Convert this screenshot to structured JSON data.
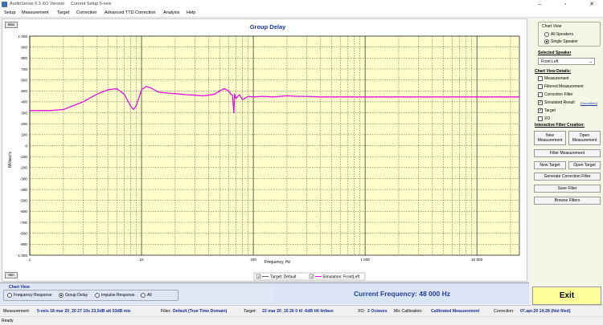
{
  "window": {
    "app_title": "AudioSense 6.3 XO Version",
    "caption": "Current Setup 5-veis",
    "minimize": "–",
    "maximize": "▫",
    "close": "✕"
  },
  "menu": [
    "Setup",
    "Measurement",
    "Target",
    "Correction",
    "Advanced TTD Correction",
    "Analysis",
    "Help"
  ],
  "chart": {
    "max_button": "Max",
    "min_button": "Min"
  },
  "chart_data": {
    "type": "line",
    "title": "Group Delay",
    "xlabel": "Frequency, Hz",
    "ylabel": "Millisec's",
    "x_scale": "log",
    "xlim": [
      1,
      24000
    ],
    "ylim": [
      -1000,
      1000
    ],
    "x_ticks": [
      1,
      10,
      100,
      1000,
      10000
    ],
    "x_tick_labels": [
      "1",
      "10",
      "100",
      "1 000",
      "10 000"
    ],
    "y_ticks": [
      1000,
      900,
      800,
      700,
      600,
      500,
      400,
      300,
      200,
      100,
      0,
      -100,
      -200,
      -300,
      -400,
      -500,
      -600,
      -700,
      -800,
      -900,
      -1000
    ],
    "y_tick_labels": [
      "1 000",
      "900",
      "800",
      "700",
      "600",
      "500",
      "400",
      "300",
      "200",
      "100",
      "0",
      "-100",
      "-200",
      "-300",
      "-400",
      "-500",
      "-600",
      "-700",
      "-800",
      "-900",
      "-1 000"
    ],
    "grid": true,
    "background": "#ffffcc",
    "series": [
      {
        "name": "Simulation: FrontLeft",
        "color": "#e010e0",
        "x": [
          1,
          1.5,
          2,
          3,
          4,
          5,
          6,
          7,
          8,
          8.5,
          9,
          10,
          11,
          12,
          13,
          14,
          17,
          20,
          25,
          30,
          35,
          40,
          45,
          50,
          55,
          60,
          63,
          65,
          66,
          67,
          68,
          70,
          75,
          80,
          90,
          100,
          120,
          150,
          200,
          250,
          300,
          400,
          600,
          1000,
          2000,
          5000,
          10000,
          24000
        ],
        "y": [
          320,
          320,
          330,
          400,
          470,
          510,
          520,
          470,
          360,
          330,
          370,
          510,
          540,
          530,
          510,
          490,
          480,
          475,
          465,
          460,
          455,
          460,
          470,
          500,
          520,
          500,
          470,
          460,
          380,
          300,
          470,
          430,
          465,
          420,
          450,
          445,
          450,
          445,
          455,
          450,
          450,
          445,
          445,
          445,
          445,
          445,
          445,
          445
        ]
      }
    ],
    "legend": {
      "placement": "bottom-center",
      "entries": [
        "Target: Default",
        "Simulation: FrontLeft"
      ]
    }
  },
  "side": {
    "chart_view_title": "Chart View",
    "all_speakers": "All Speakers",
    "single_speaker": "Single Speaker",
    "selected_speaker_title": "Selected Speaker",
    "selected_speaker_value": "Front Left",
    "details_title": "Chart View Details:",
    "details": [
      {
        "label": "Measurement",
        "checked": false
      },
      {
        "label": "Filtered Measurement",
        "checked": false
      },
      {
        "label": "Correction Filter",
        "checked": false
      },
      {
        "label": "Simulated Result",
        "checked": true
      },
      {
        "label": "Target",
        "checked": true
      },
      {
        "label": "XO",
        "checked": false
      }
    ],
    "smoothed_link": "(Smoothed)",
    "filter_creation_title": "Interactive Filter Creation:",
    "new_measurement": "New\nMeasurement",
    "open_measurement": "Open\nMeasurement",
    "filter_measurement": "Filter Measurement",
    "new_target": "New Target",
    "open_target": "Open Target",
    "generate_filter": "Generate Correction Filter",
    "save_filter": "Save Filter",
    "browse_filters": "Browse Filters"
  },
  "chartview_bottom": {
    "title": "Chart View",
    "options": [
      {
        "label": "Frequency Response",
        "selected": false
      },
      {
        "label": "Group Delay",
        "selected": true
      },
      {
        "label": "Impulse Response",
        "selected": false
      },
      {
        "label": "All",
        "selected": false
      }
    ]
  },
  "current_frequency": "Current Frequency: 48 000 Hz",
  "exit_label": "Exit",
  "info": {
    "measurement_label": "Measurement:",
    "measurement_value": "5-veis 18 mar 20_20 27 10s  23,5dB att 53dB mic",
    "filter_label": "Filter:",
    "filter_value": "Default (True Time Domain)",
    "target_label": "Target:",
    "target_value": "22 mar 20_16 26 0 til -6dB tilt linfase",
    "xo_label": "XO:",
    "xo_value": "2 Octaves",
    "mic_label": "Mic Calibration:",
    "mic_value": "Calibrated Measurement",
    "correction_label": "Correction:",
    "correction_value": "07.apr.20 14:28 (Not filed)"
  },
  "status": "Ready"
}
